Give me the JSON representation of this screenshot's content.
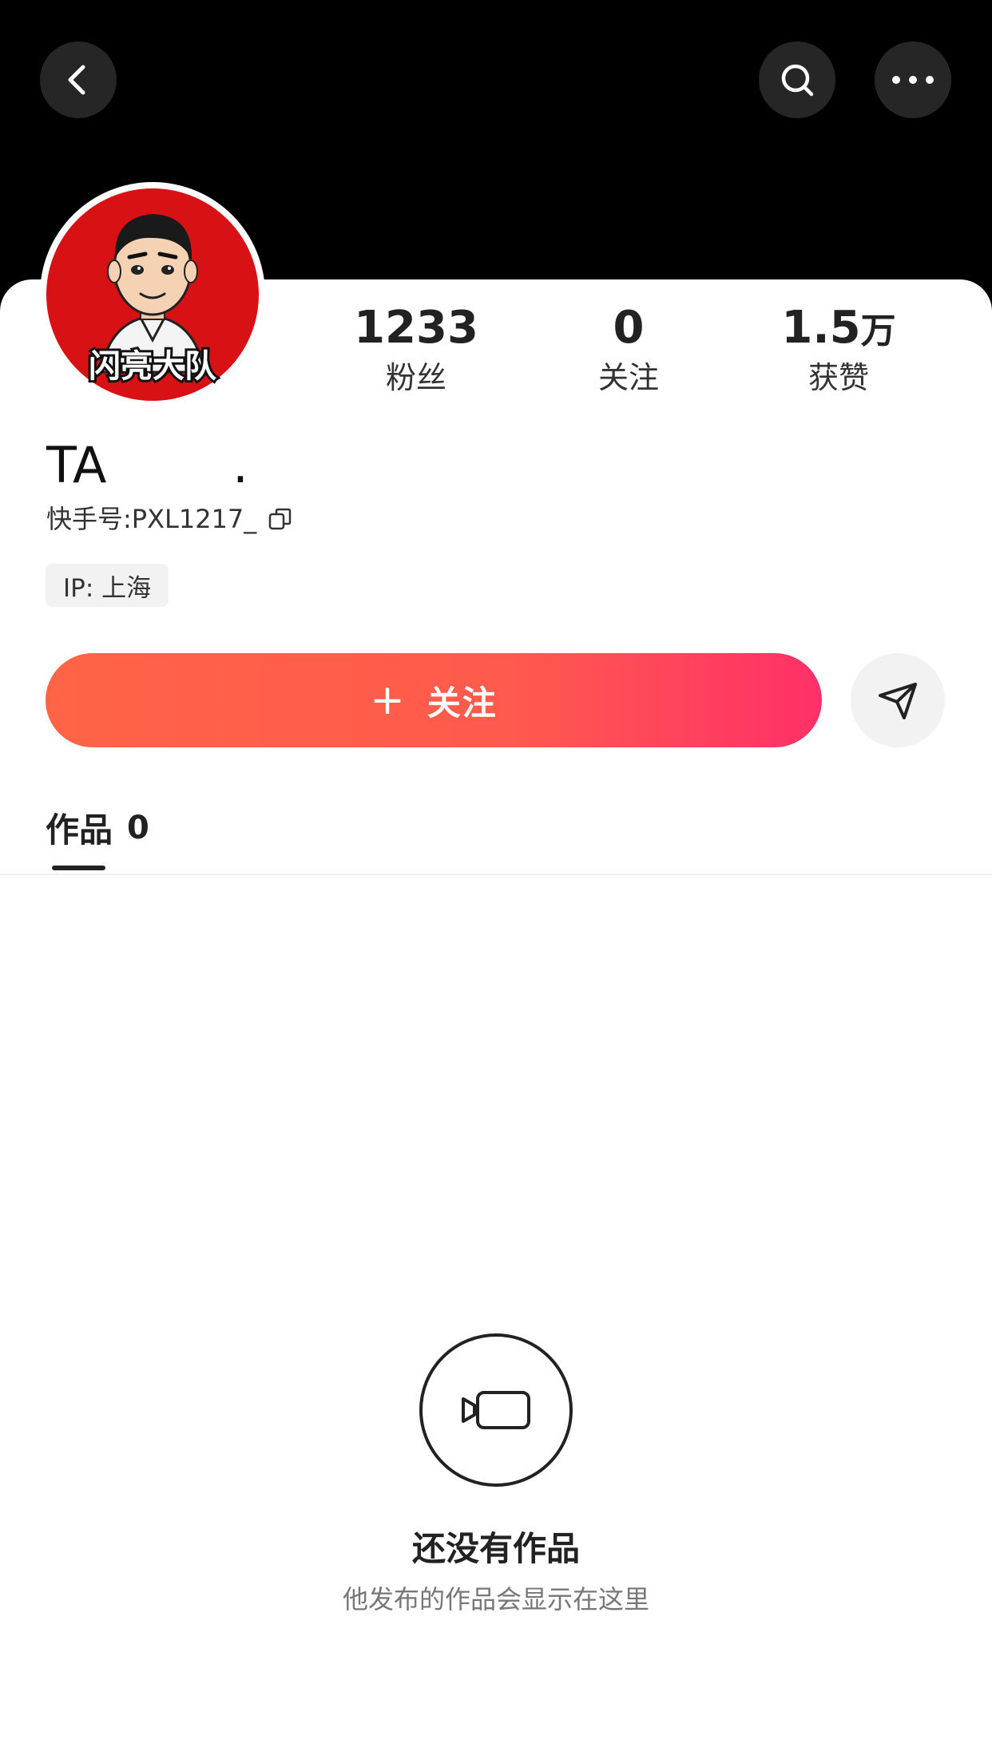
{
  "header": {
    "back_icon": "chevron-left-icon",
    "search_icon": "search-icon",
    "more_icon": "more-horizontal-icon"
  },
  "profile": {
    "avatar_logo_text": "闪亮大队",
    "avatar_colors": {
      "background": "#d81214"
    },
    "name": "TA        .",
    "uid_label": "快手号:",
    "uid_value": "PXL1217_",
    "ip_tag": "IP:  上海"
  },
  "stats": [
    {
      "value": "1233",
      "unit": "",
      "label": "粉丝"
    },
    {
      "value": "0",
      "unit": "",
      "label": "关注"
    },
    {
      "value": "1.5",
      "unit": "万",
      "label": "获赞"
    }
  ],
  "actions": {
    "follow_plus": "+",
    "follow_label": "关注",
    "follow_gradient": [
      "#ff6446",
      "#ff3068"
    ],
    "share_icon": "send-icon"
  },
  "tabs": [
    {
      "label": "作品",
      "count": "0",
      "active": true
    }
  ],
  "empty_state": {
    "icon": "video-camera-icon",
    "title": "还没有作品",
    "subtitle": "他发布的作品会显示在这里"
  }
}
